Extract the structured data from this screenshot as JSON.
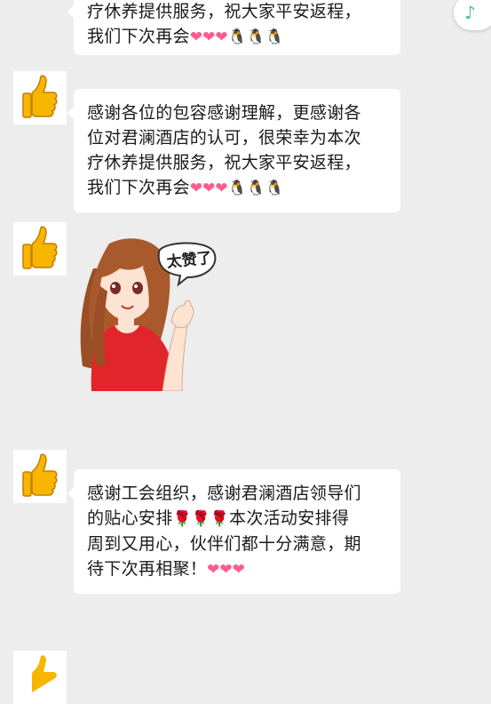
{
  "messages": [
    {
      "avatar_icon": "thumbs-up-icon",
      "lines": [
        "疗休养提供服务，祝大家平安返程，",
        "我们下次再会"
      ],
      "emoji": [
        "heart",
        "heart",
        "heart",
        "penguin",
        "penguin",
        "penguin"
      ]
    },
    {
      "avatar_icon": "thumbs-up-icon",
      "lines": [
        "感谢各位的包容感谢理解，更感谢各",
        "位对君澜酒店的认可，很荣幸为本次",
        "疗休养提供服务，祝大家平安返程，",
        "我们下次再会"
      ],
      "emoji": [
        "heart",
        "heart",
        "heart",
        "penguin",
        "penguin",
        "penguin"
      ]
    },
    {
      "avatar_icon": "thumbs-up-icon",
      "sticker_text": "太赞了"
    },
    {
      "avatar_icon": "thumbs-up-icon",
      "line1": "感谢工会组织，感谢君澜酒店领导们",
      "line2_start": "的贴心安排",
      "line2_end": "本次活动安排得",
      "line3": "周到又用心，伙伴们都十分满意，期",
      "line4": "待下次再相聚！",
      "emoji_roses": [
        "rose",
        "rose",
        "rose"
      ],
      "emoji_hearts": [
        "heart",
        "heart",
        "heart"
      ]
    }
  ],
  "music_icon": "music-note-icon",
  "colors": {
    "background": "#ededed",
    "bubble": "#ffffff",
    "music": "#41c98a"
  }
}
